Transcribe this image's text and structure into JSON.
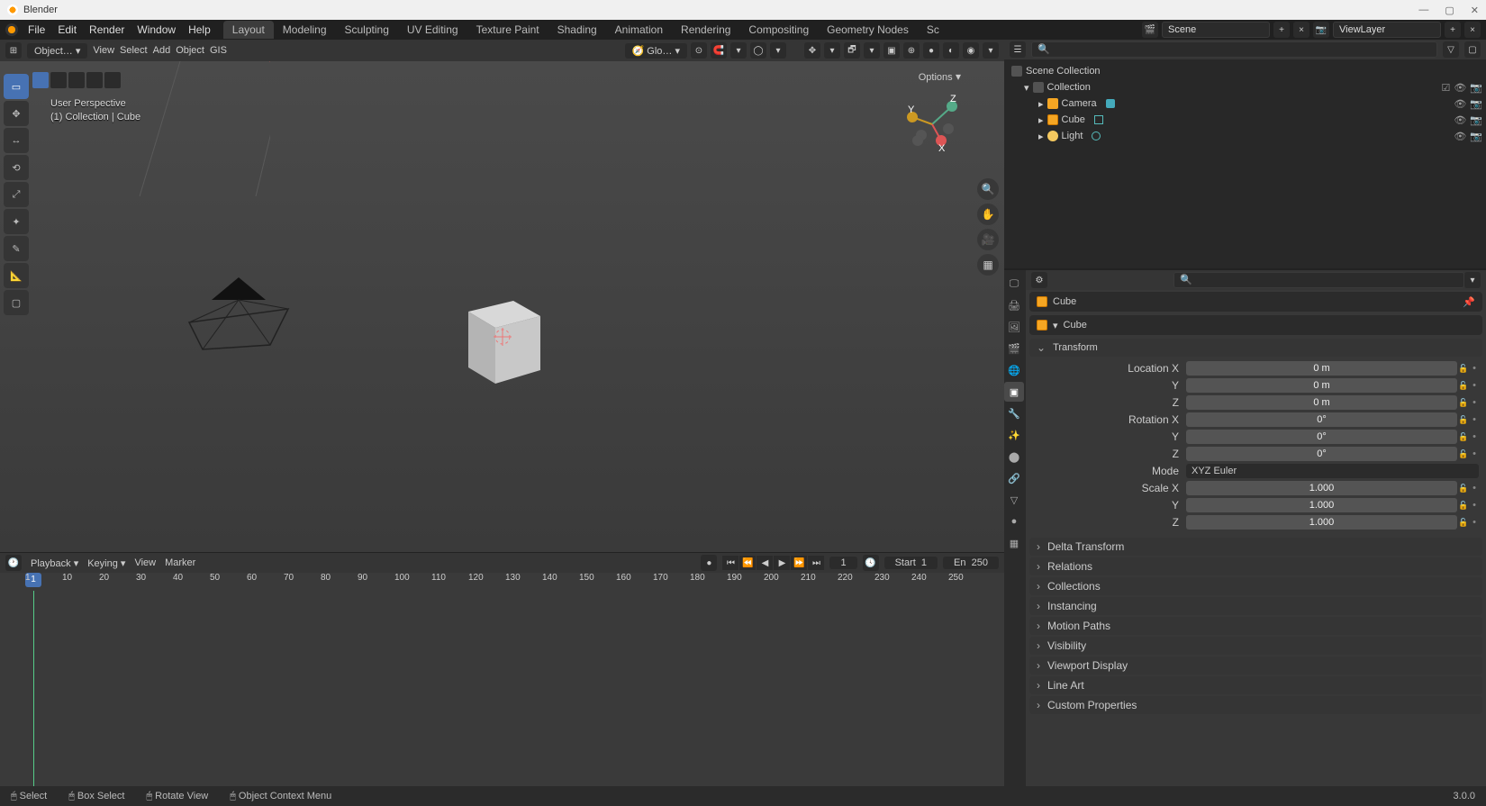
{
  "app": {
    "title": "Blender"
  },
  "winbtns": {
    "min": "—",
    "max": "▢",
    "close": "✕"
  },
  "menu": [
    "File",
    "Edit",
    "Render",
    "Window",
    "Help"
  ],
  "workspaces": [
    "Layout",
    "Modeling",
    "Sculpting",
    "UV Editing",
    "Texture Paint",
    "Shading",
    "Animation",
    "Rendering",
    "Compositing",
    "Geometry Nodes",
    "Sc"
  ],
  "scene": {
    "label": "Scene",
    "viewlayer": "ViewLayer"
  },
  "view3d": {
    "mode": "Object…",
    "menus": [
      "View",
      "Select",
      "Add",
      "Object",
      "GIS"
    ],
    "transform": "Glo…",
    "options": "Options",
    "overlay_line1": "User Perspective",
    "overlay_line2": "(1) Collection | Cube"
  },
  "timeline": {
    "menus": [
      "Playback",
      "Keying",
      "View",
      "Marker"
    ],
    "frame": "1",
    "start_label": "Start",
    "start": "1",
    "end_label": "En",
    "end": "250",
    "ticks": [
      "1",
      "10",
      "20",
      "30",
      "40",
      "50",
      "60",
      "70",
      "80",
      "90",
      "100",
      "110",
      "120",
      "130",
      "140",
      "150",
      "160",
      "170",
      "180",
      "190",
      "200",
      "210",
      "220",
      "230",
      "240",
      "250"
    ]
  },
  "outliner": {
    "root": "Scene Collection",
    "collection": "Collection",
    "items": [
      {
        "name": "Camera",
        "type": "cam"
      },
      {
        "name": "Cube",
        "type": "cubei"
      },
      {
        "name": "Light",
        "type": "lighti"
      }
    ]
  },
  "properties": {
    "obj_name": "Cube",
    "data_name": "Cube",
    "transform_title": "Transform",
    "loc_label": "Location X",
    "loc": [
      "0 m",
      "0 m",
      "0 m"
    ],
    "axes": [
      "Y",
      "Z"
    ],
    "rot_label": "Rotation X",
    "rot": [
      "0°",
      "0°",
      "0°"
    ],
    "mode_label": "Mode",
    "mode": "XYZ Euler",
    "scale_label": "Scale X",
    "scale": [
      "1.000",
      "1.000",
      "1.000"
    ],
    "panels": [
      "Delta Transform",
      "Relations",
      "Collections",
      "Instancing",
      "Motion Paths",
      "Visibility",
      "Viewport Display",
      "Line Art",
      "Custom Properties"
    ]
  },
  "status": {
    "select": "Select",
    "box": "Box Select",
    "rotate": "Rotate View",
    "context": "Object Context Menu",
    "version": "3.0.0"
  }
}
